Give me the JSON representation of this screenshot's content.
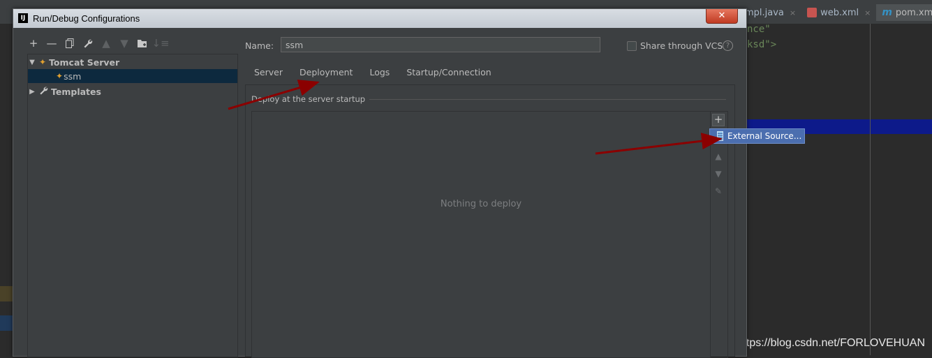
{
  "ide": {
    "tabs": [
      {
        "label": "ceImpl.java",
        "close": "×"
      },
      {
        "label": "web.xml",
        "close": "×"
      },
      {
        "label": "pom.xml",
        "active": true
      }
    ],
    "editor_lines": [
      "nce\"",
      "ksd\">"
    ],
    "watermark": "https://blog.csdn.net/FORLOVEHUAN"
  },
  "dialog": {
    "title": "Run/Debug Configurations",
    "close_label": "✕",
    "app_icon_text": "IJ"
  },
  "toolbar": {
    "icons": [
      "add-icon",
      "remove-icon",
      "copy-icon",
      "wrench-icon",
      "move-up-icon",
      "move-down-icon",
      "new-folder-icon",
      "sort-icon"
    ]
  },
  "tree": {
    "items": [
      {
        "label": "Tomcat Server",
        "expanded": true,
        "icon": "tomcat-icon"
      },
      {
        "label": "ssm",
        "icon": "tomcat-config-icon",
        "selected": true
      },
      {
        "label": "Templates",
        "expanded": false,
        "icon": "wrench-icon"
      }
    ]
  },
  "form": {
    "name_label": "Name:",
    "name_value": "ssm",
    "share_label": "Share through VCS",
    "share_checked": false,
    "help": "?"
  },
  "tabs": [
    {
      "label": "Server"
    },
    {
      "label": "Deployment",
      "active": true
    },
    {
      "label": "Logs"
    },
    {
      "label": "Startup/Connection"
    }
  ],
  "deployment": {
    "group_title": "Deploy at the server startup",
    "empty_text": "Nothing to deploy",
    "add_label": "+"
  },
  "popup": {
    "items": [
      {
        "label": "External Source..."
      }
    ]
  },
  "colors": {
    "selection": "#0d293e",
    "popup_bg": "#4b6eaf",
    "tab_underline": "#4a88c7",
    "annotation_arrow": "#8b0000"
  }
}
